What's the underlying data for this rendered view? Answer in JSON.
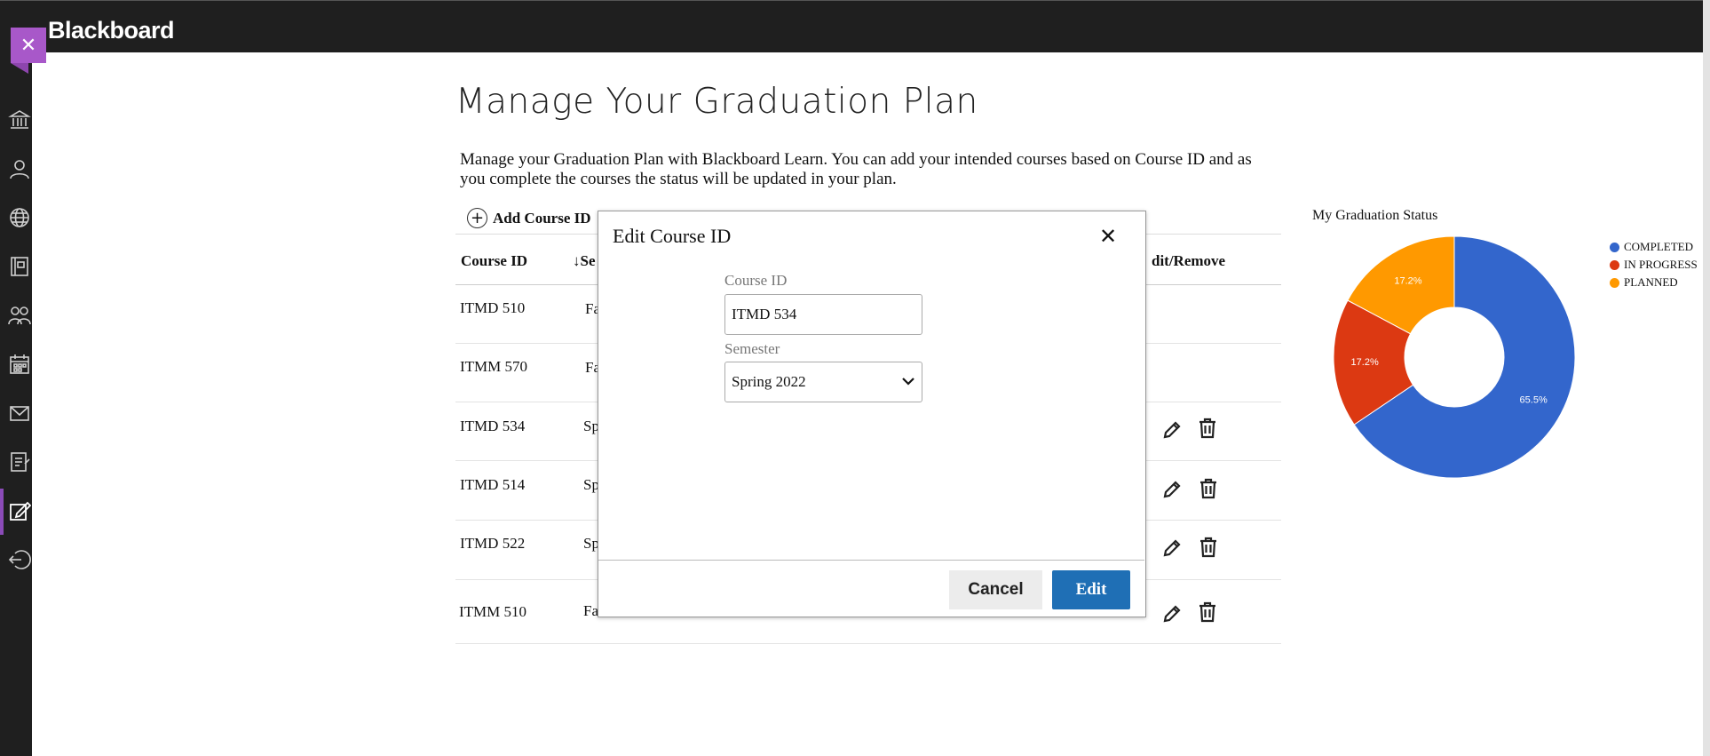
{
  "app": {
    "brand": "Blackboard"
  },
  "sidebar": {
    "items": [
      {
        "icon": "institution-icon"
      },
      {
        "icon": "profile-icon"
      },
      {
        "icon": "globe-icon"
      },
      {
        "icon": "courses-icon"
      },
      {
        "icon": "organizations-icon"
      },
      {
        "icon": "calendar-icon"
      },
      {
        "icon": "messages-icon"
      },
      {
        "icon": "grades-icon"
      },
      {
        "icon": "graduation-plan-icon",
        "active": true
      },
      {
        "icon": "sign-out-icon"
      }
    ],
    "active_color": "#8b4bb8"
  },
  "page": {
    "title": "Manage Your Graduation Plan",
    "intro": "Manage your Graduation Plan with Blackboard Learn. You can add your intended courses based on Course ID and as you complete the courses the status will be updated in your plan.",
    "add_course_label": "Add Course ID"
  },
  "table": {
    "headers": {
      "course_id": "Course ID",
      "semester": "↓Se",
      "edit_remove": "dit/Remove"
    },
    "rows": [
      {
        "course_id": "ITMD 510",
        "semester": "Fa",
        "actions": false
      },
      {
        "course_id": "ITMM 570",
        "semester": "Fa",
        "actions": false
      },
      {
        "course_id": "ITMD 534",
        "semester": "Sp",
        "actions": true
      },
      {
        "course_id": "ITMD 514",
        "semester": "Sp",
        "actions": true
      },
      {
        "course_id": "ITMD 522",
        "semester": "Sp",
        "actions": true
      },
      {
        "course_id": "ITMM 510",
        "semester": "Fa",
        "actions": true
      }
    ]
  },
  "status_chart": {
    "title": "My Graduation Status"
  },
  "chart_data": {
    "type": "pie",
    "donut": true,
    "title": "My Graduation Status",
    "labels": [
      "COMPLETED",
      "IN PROGRESS",
      "PLANNED"
    ],
    "values": [
      65.5,
      17.2,
      17.2
    ],
    "value_labels": [
      "65.5%",
      "17.2%",
      "17.2%"
    ],
    "colors": [
      "#3366cc",
      "#dc3912",
      "#ff9900"
    ],
    "legend_position": "right"
  },
  "modal": {
    "title": "Edit Course ID",
    "course_id_label": "Course ID",
    "course_id_value": "ITMD 534",
    "semester_label": "Semester",
    "semester_value": "Spring 2022",
    "cancel_label": "Cancel",
    "edit_label": "Edit",
    "primary_color": "#1f6fb5"
  }
}
